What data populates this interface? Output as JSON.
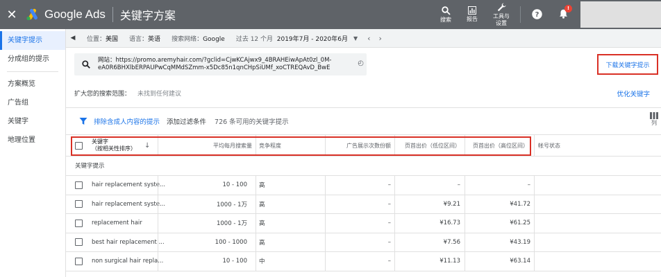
{
  "topbar": {
    "close_icon": "close-icon",
    "brand": "Google Ads",
    "title": "关键字方案",
    "search_label": "搜索",
    "reports_label": "报告",
    "tools_label_1": "工具与",
    "tools_label_2": "设置",
    "notification_badge": "!"
  },
  "sidebar": {
    "items": [
      {
        "label": "关键字提示",
        "active": true
      },
      {
        "label": "分成组的提示"
      },
      {
        "label": "方案概览"
      },
      {
        "label": "广告组"
      },
      {
        "label": "关键字"
      },
      {
        "label": "地理位置"
      }
    ]
  },
  "filterbar": {
    "location_label": "位置：",
    "location_value": "美国",
    "language_label": "语言：",
    "language_value": "英语",
    "network_label": "搜索网络：",
    "network_value": "Google",
    "period_label": "过去 12 个月",
    "period_value": "2019年7月 - 2020年6月"
  },
  "urlbox": {
    "line1": "网站：https://promo.aremyhair.com/?gclid=CjwKCAjwx9_4BRAHEiwApAt0zl_0M-",
    "line2": "eA0R6BHXlbERPAUPwCqMMdSZmm-x5Dc85n1qnCHpSiUMf_xoCTREQAvD_BwE"
  },
  "download_label": "下载关键字提示",
  "expand": {
    "label": "扩大您的搜索范围：",
    "value": "未找到任何建议",
    "refine": "优化关键字"
  },
  "toolbar2": {
    "exclude_adult": "排除含成人内容的提示",
    "add_filter": "添加过滤条件",
    "count": "726 条可用的关键字提示",
    "columns_label": "列"
  },
  "table": {
    "headers": {
      "keyword_1": "关键字",
      "keyword_2": "（按相关性排序）",
      "volume": "平均每月搜索量",
      "competition": "竞争程度",
      "impression_share": "广告展示次数份额",
      "bid_low": "页首出价（低位区间）",
      "bid_high": "页首出价（高位区间）",
      "account_status": "帐号状态"
    },
    "group_label": "关键字提示",
    "rows": [
      {
        "keyword": "hair replacement syste...",
        "volume": "10 - 100",
        "competition": "高",
        "share": "–",
        "low": "–",
        "high": "–"
      },
      {
        "keyword": "hair replacement syste...",
        "volume": "1000 - 1万",
        "competition": "高",
        "share": "–",
        "low": "¥9.21",
        "high": "¥41.72"
      },
      {
        "keyword": "replacement hair",
        "volume": "1000 - 1万",
        "competition": "高",
        "share": "–",
        "low": "¥16.73",
        "high": "¥61.25"
      },
      {
        "keyword": "best hair replacement ...",
        "volume": "100 - 1000",
        "competition": "高",
        "share": "–",
        "low": "¥7.56",
        "high": "¥43.19"
      },
      {
        "keyword": "non surgical hair repla...",
        "volume": "10 - 100",
        "competition": "中",
        "share": "–",
        "low": "¥11.13",
        "high": "¥63.14"
      }
    ]
  },
  "colors": {
    "topbar": "#5f6368",
    "accent": "#1a73e8",
    "highlight_border": "#d93025"
  }
}
